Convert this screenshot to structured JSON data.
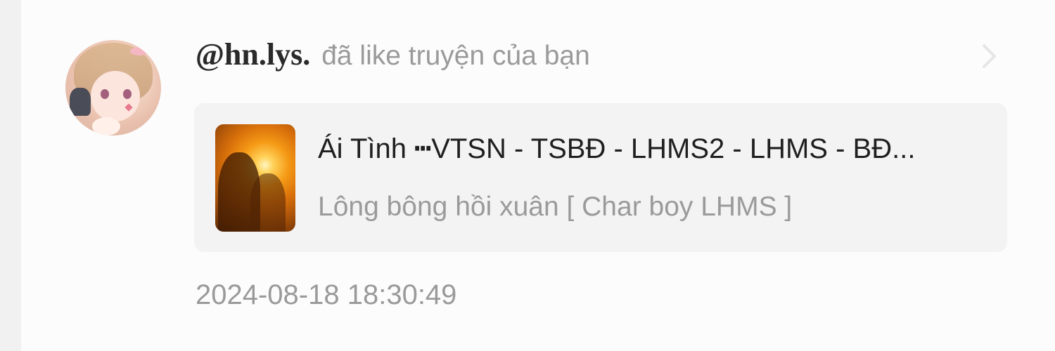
{
  "notification": {
    "username": "@hn.lys.",
    "action": "đã like truyện của bạn",
    "timestamp": "2024-08-18 18:30:49"
  },
  "story": {
    "title": "Ái Tình ┅VTSN - TSBĐ - LHMS2 - LHMS - BĐ...",
    "subtitle": "Lông bông hồi xuân [ Char boy LHMS ]"
  },
  "icons": {
    "open": "chevron-right-icon"
  },
  "colors": {
    "card_background": "#fcfcfc",
    "story_background": "#f3f3f4",
    "muted_text": "#9a9a9a",
    "primary_text": "#1f1f1f"
  }
}
